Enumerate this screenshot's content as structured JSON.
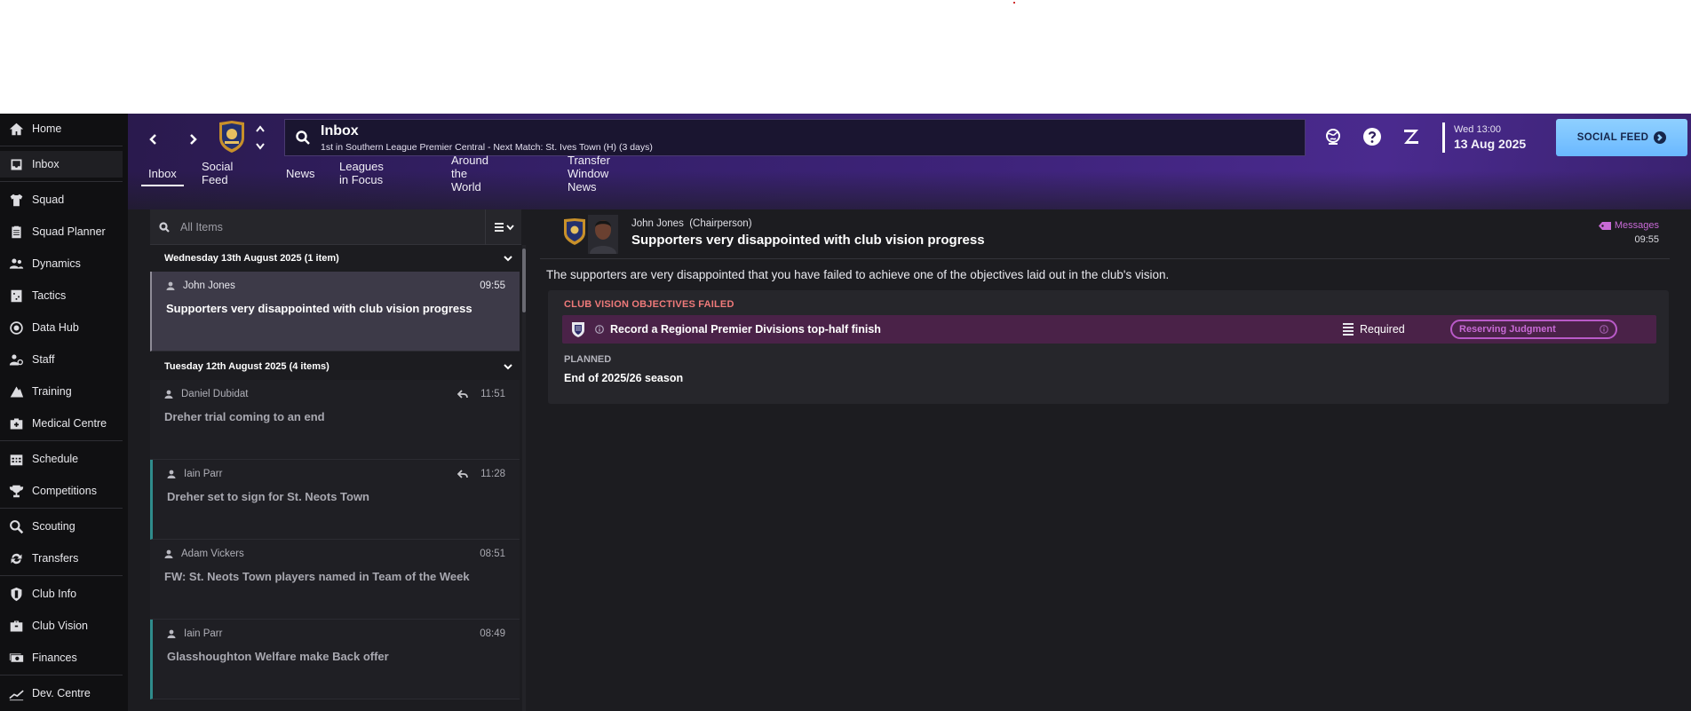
{
  "sidebar": {
    "items": [
      {
        "label": "Home",
        "icon": "home-icon"
      },
      {
        "label": "Inbox",
        "icon": "inbox-icon"
      },
      {
        "label": "Squad",
        "icon": "shirt-icon"
      },
      {
        "label": "Squad Planner",
        "icon": "clipboard-icon"
      },
      {
        "label": "Dynamics",
        "icon": "people-icon"
      },
      {
        "label": "Tactics",
        "icon": "tactics-board-icon"
      },
      {
        "label": "Data Hub",
        "icon": "data-circle-icon"
      },
      {
        "label": "Staff",
        "icon": "staff-icon"
      },
      {
        "label": "Training",
        "icon": "training-icon"
      },
      {
        "label": "Medical Centre",
        "icon": "medical-kit-icon"
      },
      {
        "label": "Schedule",
        "icon": "calendar-icon"
      },
      {
        "label": "Competitions",
        "icon": "trophy-icon"
      },
      {
        "label": "Scouting",
        "icon": "magnifier-icon"
      },
      {
        "label": "Transfers",
        "icon": "transfer-arrows-icon"
      },
      {
        "label": "Club Info",
        "icon": "shield-icon"
      },
      {
        "label": "Club Vision",
        "icon": "briefcase-icon"
      },
      {
        "label": "Finances",
        "icon": "banknotes-icon"
      },
      {
        "label": "Dev. Centre",
        "icon": "growth-chart-icon"
      }
    ]
  },
  "header": {
    "search_title": "Inbox",
    "search_subtitle": "1st in Southern League Premier Central - Next Match: St. Ives Town (H) (3 days)",
    "date_time": "Wed 13:00",
    "date_day": "13 Aug 2025",
    "social_button": "SOCIAL FEED",
    "tabs": [
      "Inbox",
      "Social Feed",
      "News",
      "Leagues in Focus",
      "Around the World",
      "Transfer Window News"
    ]
  },
  "list": {
    "filter_placeholder": "All Items",
    "groups": [
      {
        "title": "Wednesday 13th August 2025 (1 item)"
      },
      {
        "title": "Tuesday 12th August 2025 (4 items)"
      }
    ],
    "messages": [
      {
        "sender": "John Jones",
        "time": "09:55",
        "subject": "Supporters very disappointed with club vision progress"
      },
      {
        "sender": "Daniel Dubidat",
        "time": "11:51",
        "subject": "Dreher trial coming to an end"
      },
      {
        "sender": "Iain Parr",
        "time": "11:28",
        "subject": "Dreher set to sign for St. Neots Town"
      },
      {
        "sender": "Adam Vickers",
        "time": "08:51",
        "subject": "FW: St. Neots Town players named in Team of the Week"
      },
      {
        "sender": "Iain Parr",
        "time": "08:49",
        "subject": "Glasshoughton Welfare make Back offer"
      }
    ]
  },
  "reader": {
    "from_name": "John Jones",
    "from_role": "(Chairperson)",
    "subject": "Supporters very disappointed with club vision progress",
    "tag": "Messages",
    "time": "09:55",
    "body": "The supporters are very disappointed that you have failed to achieve one of the objectives laid out in the club's vision.",
    "card": {
      "title": "CLUB VISION OBJECTIVES FAILED",
      "objective": "Record a Regional Premier Divisions top-half finish",
      "importance": "Required",
      "status": "Reserving Judgment",
      "planned_label": "PLANNED",
      "planned_value": "End of 2025/26 season"
    }
  },
  "colors": {
    "accent_teal": "#2f8c8c",
    "fail_red": "#f07a7a",
    "badge_purple": "#c86ad6",
    "social_blue": "#8fd0ff"
  }
}
